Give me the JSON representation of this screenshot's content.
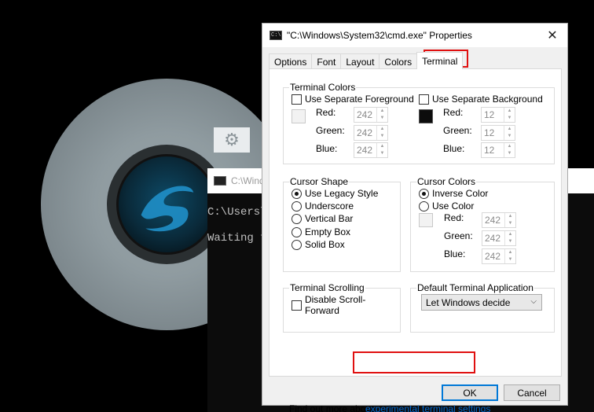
{
  "desktop": {
    "console_title": "C:\\Windo",
    "console_lines": [
      "C:\\Users\\",
      "Waiting f"
    ]
  },
  "dialog": {
    "title": "\"C:\\Windows\\System32\\cmd.exe\" Properties",
    "close_glyph": "✕",
    "tabs": [
      "Options",
      "Font",
      "Layout",
      "Colors",
      "Terminal"
    ],
    "active_tab": "Terminal",
    "terminal_colors": {
      "title": "Terminal Colors",
      "foreground": {
        "checkbox_label": "Use Separate Foreground",
        "checked": false,
        "red_label": "Red:",
        "green_label": "Green:",
        "blue_label": "Blue:",
        "red": "242",
        "green": "242",
        "blue": "242",
        "swatch_color": "#f2f2f2"
      },
      "background": {
        "checkbox_label": "Use Separate Background",
        "checked": false,
        "red_label": "Red:",
        "green_label": "Green:",
        "blue_label": "Blue:",
        "red": "12",
        "green": "12",
        "blue": "12",
        "swatch_color": "#0c0c0c"
      }
    },
    "cursor_shape": {
      "title": "Cursor Shape",
      "options": [
        "Use Legacy Style",
        "Underscore",
        "Vertical Bar",
        "Empty Box",
        "Solid Box"
      ],
      "selected": "Use Legacy Style"
    },
    "cursor_colors": {
      "title": "Cursor Colors",
      "options": [
        "Inverse Color",
        "Use Color"
      ],
      "selected": "Inverse Color",
      "red_label": "Red:",
      "green_label": "Green:",
      "blue_label": "Blue:",
      "red": "242",
      "green": "242",
      "blue": "242",
      "swatch_color": "#f2f2f2"
    },
    "terminal_scrolling": {
      "title": "Terminal Scrolling",
      "checkbox_label": "Disable Scroll-Forward",
      "checked": false
    },
    "default_terminal": {
      "title": "Default Terminal Application",
      "selected": "Let Windows decide"
    },
    "find_out_text": "Find out more about",
    "link_text": "experimental terminal settings",
    "ok_label": "OK",
    "cancel_label": "Cancel"
  },
  "colors": {
    "highlight": "#e01010",
    "link": "#0066cc",
    "default_button_border": "#0078d7"
  }
}
